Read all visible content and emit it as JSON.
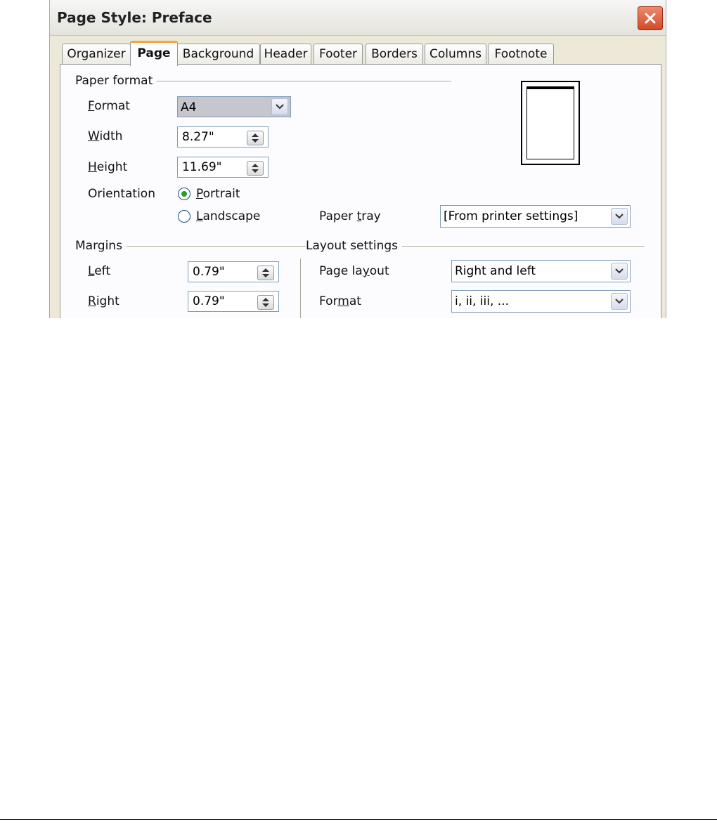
{
  "window": {
    "title": "Page Style: Preface"
  },
  "tabs": [
    "Organizer",
    "Page",
    "Background",
    "Header",
    "Footer",
    "Borders",
    "Columns",
    "Footnote"
  ],
  "active_tab": "Page",
  "paper_format": {
    "group_label": "Paper format",
    "format": {
      "label_u": "F",
      "label_rest": "ormat",
      "value": "A4"
    },
    "width": {
      "label_u": "W",
      "label_rest": "idth",
      "value": "8.27\""
    },
    "height": {
      "label_u": "H",
      "label_rest": "eight",
      "value": "11.69\""
    },
    "orientation": {
      "label": "Orientation",
      "portrait": {
        "label_u": "P",
        "label_rest": "ortrait",
        "selected": true
      },
      "landscape": {
        "label_u": "L",
        "label_rest": "andscape",
        "selected": false
      }
    },
    "paper_tray": {
      "label_pre": "Paper ",
      "label_u": "t",
      "label_rest": "ray",
      "value": "[From printer settings]"
    }
  },
  "margins": {
    "group_label": "Margins",
    "left": {
      "label_u": "L",
      "label_rest": "eft",
      "value": "0.79\""
    },
    "right": {
      "label_u": "R",
      "label_rest": "ight",
      "value": "0.79\""
    }
  },
  "layout_settings": {
    "group_label": "Layout settings",
    "page_layout": {
      "label_pre": "Page la",
      "label_u": "y",
      "label_rest": "out",
      "value": "Right and left"
    },
    "format": {
      "label_pre": "For",
      "label_u": "m",
      "label_rest": "at",
      "value": "i, ii, iii, ..."
    }
  },
  "colors": {
    "active_tab_accent": "#f3a73b",
    "close_button": "#d24a26",
    "radio_dot": "#21a121",
    "field_border": "#7f9db9"
  },
  "icons": [
    "close-icon",
    "spin-arrows-icon",
    "dropdown-arrow-icon",
    "page-preview-icon"
  ]
}
